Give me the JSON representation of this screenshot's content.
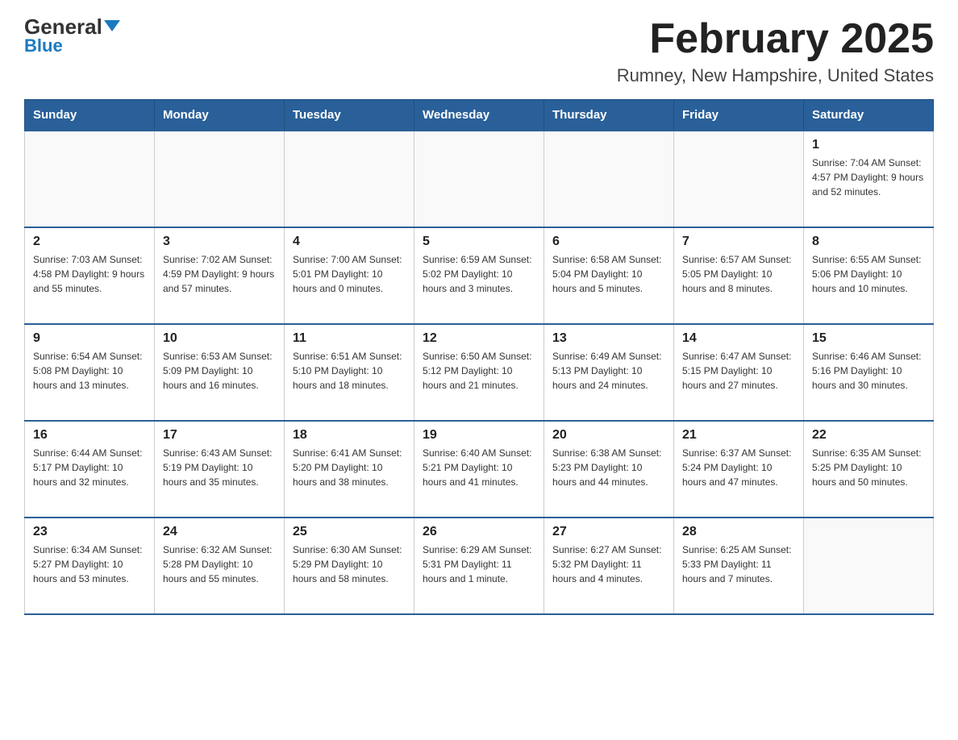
{
  "header": {
    "logo_general": "General",
    "logo_blue": "Blue",
    "month_title": "February 2025",
    "location": "Rumney, New Hampshire, United States"
  },
  "weekdays": [
    "Sunday",
    "Monday",
    "Tuesday",
    "Wednesday",
    "Thursday",
    "Friday",
    "Saturday"
  ],
  "weeks": [
    [
      {
        "day": "",
        "info": ""
      },
      {
        "day": "",
        "info": ""
      },
      {
        "day": "",
        "info": ""
      },
      {
        "day": "",
        "info": ""
      },
      {
        "day": "",
        "info": ""
      },
      {
        "day": "",
        "info": ""
      },
      {
        "day": "1",
        "info": "Sunrise: 7:04 AM\nSunset: 4:57 PM\nDaylight: 9 hours\nand 52 minutes."
      }
    ],
    [
      {
        "day": "2",
        "info": "Sunrise: 7:03 AM\nSunset: 4:58 PM\nDaylight: 9 hours\nand 55 minutes."
      },
      {
        "day": "3",
        "info": "Sunrise: 7:02 AM\nSunset: 4:59 PM\nDaylight: 9 hours\nand 57 minutes."
      },
      {
        "day": "4",
        "info": "Sunrise: 7:00 AM\nSunset: 5:01 PM\nDaylight: 10 hours\nand 0 minutes."
      },
      {
        "day": "5",
        "info": "Sunrise: 6:59 AM\nSunset: 5:02 PM\nDaylight: 10 hours\nand 3 minutes."
      },
      {
        "day": "6",
        "info": "Sunrise: 6:58 AM\nSunset: 5:04 PM\nDaylight: 10 hours\nand 5 minutes."
      },
      {
        "day": "7",
        "info": "Sunrise: 6:57 AM\nSunset: 5:05 PM\nDaylight: 10 hours\nand 8 minutes."
      },
      {
        "day": "8",
        "info": "Sunrise: 6:55 AM\nSunset: 5:06 PM\nDaylight: 10 hours\nand 10 minutes."
      }
    ],
    [
      {
        "day": "9",
        "info": "Sunrise: 6:54 AM\nSunset: 5:08 PM\nDaylight: 10 hours\nand 13 minutes."
      },
      {
        "day": "10",
        "info": "Sunrise: 6:53 AM\nSunset: 5:09 PM\nDaylight: 10 hours\nand 16 minutes."
      },
      {
        "day": "11",
        "info": "Sunrise: 6:51 AM\nSunset: 5:10 PM\nDaylight: 10 hours\nand 18 minutes."
      },
      {
        "day": "12",
        "info": "Sunrise: 6:50 AM\nSunset: 5:12 PM\nDaylight: 10 hours\nand 21 minutes."
      },
      {
        "day": "13",
        "info": "Sunrise: 6:49 AM\nSunset: 5:13 PM\nDaylight: 10 hours\nand 24 minutes."
      },
      {
        "day": "14",
        "info": "Sunrise: 6:47 AM\nSunset: 5:15 PM\nDaylight: 10 hours\nand 27 minutes."
      },
      {
        "day": "15",
        "info": "Sunrise: 6:46 AM\nSunset: 5:16 PM\nDaylight: 10 hours\nand 30 minutes."
      }
    ],
    [
      {
        "day": "16",
        "info": "Sunrise: 6:44 AM\nSunset: 5:17 PM\nDaylight: 10 hours\nand 32 minutes."
      },
      {
        "day": "17",
        "info": "Sunrise: 6:43 AM\nSunset: 5:19 PM\nDaylight: 10 hours\nand 35 minutes."
      },
      {
        "day": "18",
        "info": "Sunrise: 6:41 AM\nSunset: 5:20 PM\nDaylight: 10 hours\nand 38 minutes."
      },
      {
        "day": "19",
        "info": "Sunrise: 6:40 AM\nSunset: 5:21 PM\nDaylight: 10 hours\nand 41 minutes."
      },
      {
        "day": "20",
        "info": "Sunrise: 6:38 AM\nSunset: 5:23 PM\nDaylight: 10 hours\nand 44 minutes."
      },
      {
        "day": "21",
        "info": "Sunrise: 6:37 AM\nSunset: 5:24 PM\nDaylight: 10 hours\nand 47 minutes."
      },
      {
        "day": "22",
        "info": "Sunrise: 6:35 AM\nSunset: 5:25 PM\nDaylight: 10 hours\nand 50 minutes."
      }
    ],
    [
      {
        "day": "23",
        "info": "Sunrise: 6:34 AM\nSunset: 5:27 PM\nDaylight: 10 hours\nand 53 minutes."
      },
      {
        "day": "24",
        "info": "Sunrise: 6:32 AM\nSunset: 5:28 PM\nDaylight: 10 hours\nand 55 minutes."
      },
      {
        "day": "25",
        "info": "Sunrise: 6:30 AM\nSunset: 5:29 PM\nDaylight: 10 hours\nand 58 minutes."
      },
      {
        "day": "26",
        "info": "Sunrise: 6:29 AM\nSunset: 5:31 PM\nDaylight: 11 hours\nand 1 minute."
      },
      {
        "day": "27",
        "info": "Sunrise: 6:27 AM\nSunset: 5:32 PM\nDaylight: 11 hours\nand 4 minutes."
      },
      {
        "day": "28",
        "info": "Sunrise: 6:25 AM\nSunset: 5:33 PM\nDaylight: 11 hours\nand 7 minutes."
      },
      {
        "day": "",
        "info": ""
      }
    ]
  ]
}
